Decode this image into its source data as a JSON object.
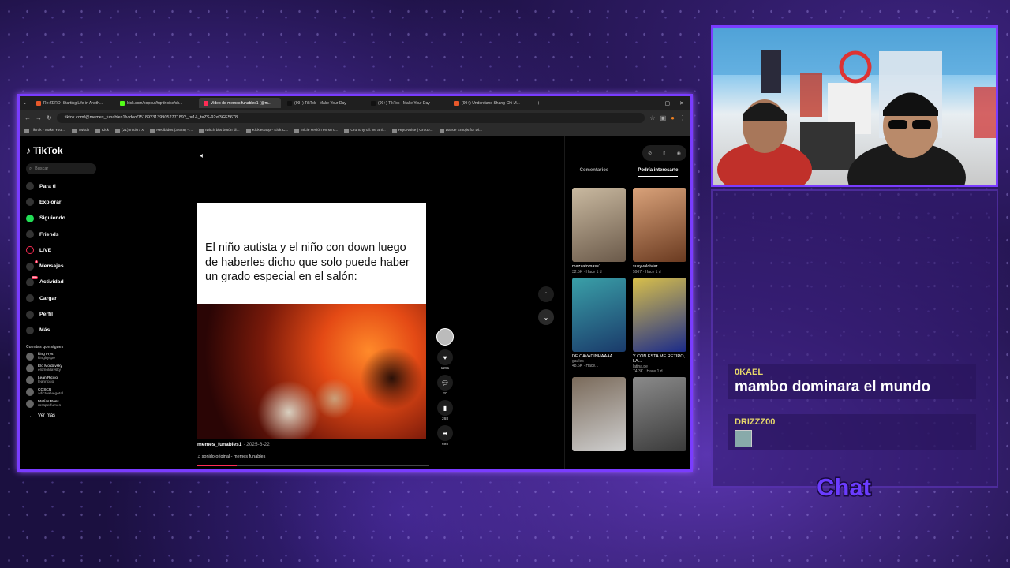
{
  "browser": {
    "tabs": [
      {
        "label": "Re:ZERO -Starting Life in Anoth...",
        "color": "#e8582a"
      },
      {
        "label": "kick.com/popout/hqrdnoise/ch...",
        "color": "#53fc18"
      },
      {
        "label": "Video de memes funables1 (@m...",
        "color": "#fe2c55",
        "active": true
      },
      {
        "label": "(99+) TikTok - Make Your Day",
        "color": "#111111"
      },
      {
        "label": "(99+) TikTok - Make Your Day",
        "color": "#111111"
      },
      {
        "label": "(99+) Understand Shang-Chi M...",
        "color": "#e8582a"
      }
    ],
    "url": "tiktok.com/@memes_funables1/video/7518923139905277189?_r=1&_t=ZS-92xt3GE5678",
    "bookmarks": [
      "TikTok - Make Your...",
      "Twitch",
      "Kick",
      "(21) Inicio / X",
      "Recibidos (3,628) - ...",
      "twitch bits botón di...",
      "Kicklet.app - Kick C...",
      "Inicie sesión en su c...",
      "Crunchyroll: Ve ani...",
      "HqrdNoise | Group...",
      "Dance Emojis for Di..."
    ]
  },
  "tiktok": {
    "logo": "TikTok",
    "search_placeholder": "Buscar",
    "nav": [
      {
        "label": "Para ti",
        "icon": "home-icon"
      },
      {
        "label": "Explorar",
        "icon": "compass-icon"
      },
      {
        "label": "Siguiendo",
        "icon": "following-icon"
      },
      {
        "label": "Friends",
        "icon": "friends-icon"
      },
      {
        "label": "LIVE",
        "icon": "live-icon"
      },
      {
        "label": "Mensajes",
        "icon": "messages-icon",
        "badge": "9"
      },
      {
        "label": "Actividad",
        "icon": "activity-icon",
        "badge": "99+"
      },
      {
        "label": "Cargar",
        "icon": "upload-icon"
      },
      {
        "label": "Perfil",
        "icon": "profile-icon"
      },
      {
        "label": "Más",
        "icon": "more-icon"
      }
    ],
    "following_title": "Cuentas que sigues",
    "following": [
      {
        "name": "king Frys",
        "handle": "kingfryspe"
      },
      {
        "name": "Elo Moldavsky",
        "handle": "elomoldavsky"
      },
      {
        "name": "Lean Riccio",
        "handle": "leanriccio"
      },
      {
        "name": "COSCU",
        "handle": "adictoalvegetal"
      },
      {
        "name": "Matías Ross",
        "handle": "rossperfumes"
      }
    ],
    "see_more": "Ver más",
    "video": {
      "caption": "El niño autista y el niño con down luego de haberles dicho que solo puede haber un grado especial en el salón:",
      "author": "memes_funables1",
      "date": "2025-6-22",
      "sound": "sonido original - memes funables",
      "progress": 0.17
    },
    "actions": {
      "likes": "1291",
      "comments": "20",
      "saves": "268",
      "shares": "698"
    },
    "right_tabs": [
      "Comentarios",
      "Podría interesarte"
    ],
    "recommendations": [
      {
        "title": "mazzatomass1",
        "stats": "32.5K · Hace 1 d",
        "c1": "#6b5a4a",
        "c2": "#c9b9a0"
      },
      {
        "title": "susyvaldiviar",
        "stats": "5967 · Hace 1 d",
        "c1": "#6a3a20",
        "c2": "#d9a27a"
      },
      {
        "title": "DE CAVADINHAAAA...",
        "stats": "gaules",
        "stats2": "48.6K · Hace...",
        "c1": "#1a3a6a",
        "c2": "#3aa0a8"
      },
      {
        "title": "Y CON ESTA ME RETIRO, LA...",
        "stats": "latina.pe",
        "stats2": "74.3K · Hace 1 d",
        "c1": "#1a2a8a",
        "c2": "#d9c04a"
      },
      {
        "title": "",
        "stats": "",
        "c1": "#cfcfcf",
        "c2": "#7a6a5a"
      },
      {
        "title": "",
        "stats": "",
        "c1": "#3a3a3a",
        "c2": "#8a8a8a"
      }
    ]
  },
  "chat": {
    "messages": [
      {
        "user": "0KAEL",
        "text": "mambo dominara el mundo"
      },
      {
        "user": "DRIZZZ00",
        "text": ""
      }
    ],
    "label": "Chat"
  }
}
